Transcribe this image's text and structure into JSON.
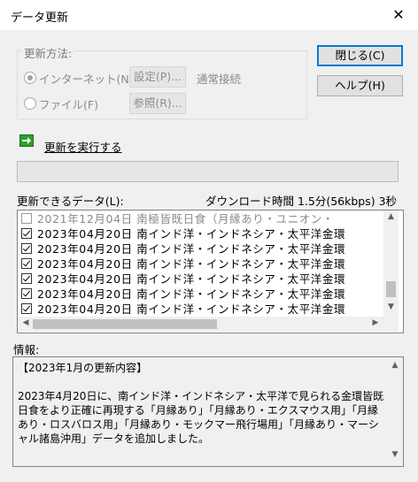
{
  "window": {
    "title": "データ更新",
    "close_glyph": "✕"
  },
  "update_method": {
    "label": "更新方法:",
    "internet_label": "インターネット(N)",
    "settings_button": "設定(P)...",
    "connection_status": "通常接続",
    "file_label": "ファイル(F)",
    "browse_button": "参照(R)...",
    "selected": "internet"
  },
  "buttons": {
    "close": "閉じる(C)",
    "help": "ヘルプ(H)"
  },
  "execute": {
    "icon": "arrow-right-icon",
    "label": "更新を実行する"
  },
  "progress": {
    "value": 0
  },
  "list": {
    "label": "更新できるデータ(L):",
    "download_time": "ダウンロード時間 1.5分(56kbps) 3秒",
    "rows": [
      {
        "checked": false,
        "dim": true,
        "text": "2021年12月04日  南極皆既日食（月縁あり・ユニオン・"
      },
      {
        "checked": true,
        "dim": false,
        "text": "2023年04月20日  南インド洋・インドネシア・太平洋金環"
      },
      {
        "checked": true,
        "dim": false,
        "text": "2023年04月20日  南インド洋・インドネシア・太平洋金環"
      },
      {
        "checked": true,
        "dim": false,
        "text": "2023年04月20日  南インド洋・インドネシア・太平洋金環"
      },
      {
        "checked": true,
        "dim": false,
        "text": "2023年04月20日  南インド洋・インドネシア・太平洋金環"
      },
      {
        "checked": true,
        "dim": false,
        "text": "2023年04月20日  南インド洋・インドネシア・太平洋金環"
      },
      {
        "checked": true,
        "dim": false,
        "text": "2023年04月20日  南インド洋・インドネシア・太平洋金環"
      }
    ]
  },
  "info": {
    "label": "情報:",
    "text": "【2023年1月の更新内容】\n\n2023年4月20日に、南インド洋・インドネシア・太平洋で見られる金環皆既日食をより正確に再現する「月縁あり」「月縁あり・エクスマウス用」「月縁あり・ロスバロス用」「月縁あり・モックマー飛行場用」「月縁あり・マーシャル諸島沖用」データを追加しました。"
  },
  "colors": {
    "accent": "#0078d7",
    "green_icon": "#2e9e2e"
  }
}
